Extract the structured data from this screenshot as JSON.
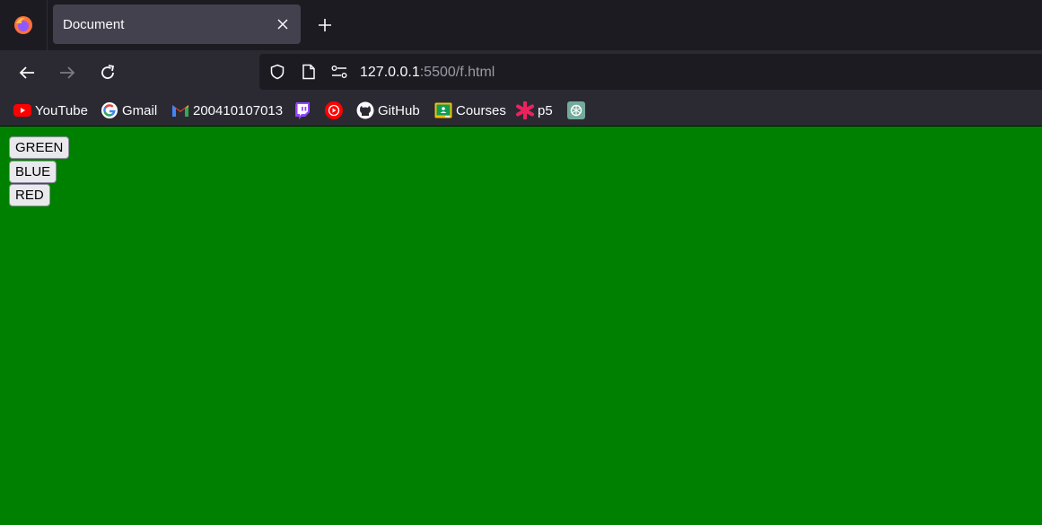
{
  "browser": {
    "tab": {
      "title": "Document"
    },
    "url": {
      "host": "127.0.0.1",
      "rest": ":5500/f.html"
    },
    "bookmarks": [
      {
        "label": "YouTube",
        "icon": "youtube-icon"
      },
      {
        "label": "Gmail",
        "icon": "google-icon"
      },
      {
        "label": "200410107013",
        "icon": "gmail-icon"
      },
      {
        "label": "",
        "icon": "twitch-icon"
      },
      {
        "label": "",
        "icon": "youtube-music-icon"
      },
      {
        "label": "GitHub",
        "icon": "github-icon"
      },
      {
        "label": "Courses",
        "icon": "classroom-icon"
      },
      {
        "label": "p5",
        "icon": "p5-icon"
      },
      {
        "label": "",
        "icon": "chatgpt-icon"
      }
    ]
  },
  "page": {
    "background": "#008000",
    "buttons": [
      {
        "label": "GREEN"
      },
      {
        "label": "BLUE"
      },
      {
        "label": "RED"
      }
    ]
  }
}
